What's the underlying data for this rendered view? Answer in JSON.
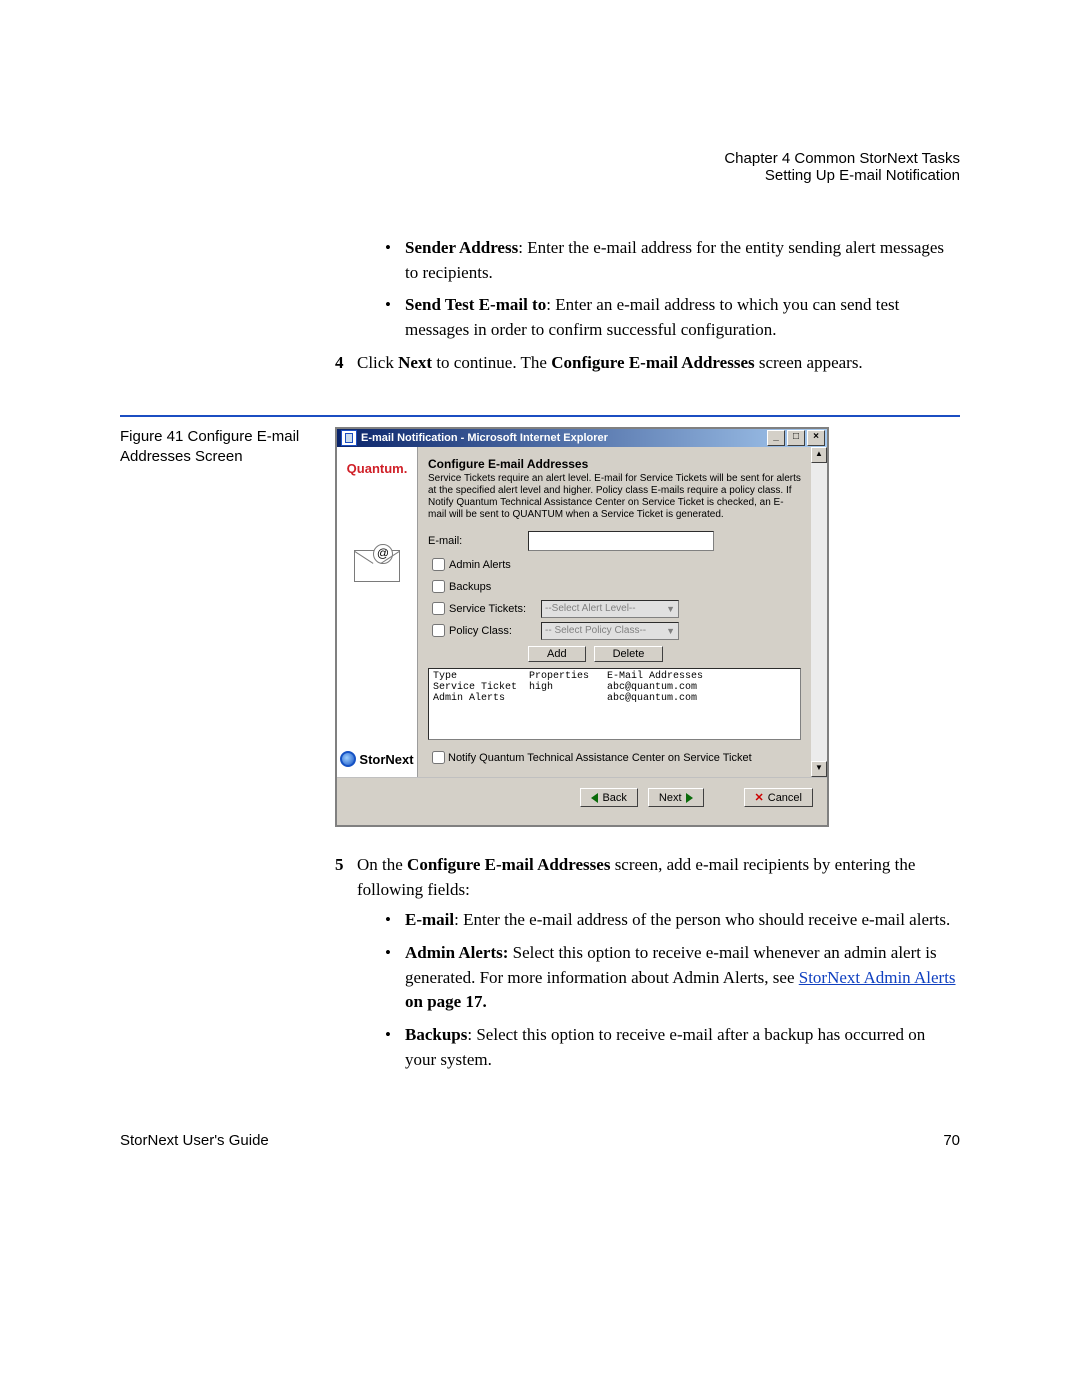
{
  "header": {
    "chapter": "Chapter 4  Common StorNext Tasks",
    "section": "Setting Up E-mail Notification"
  },
  "bullets_top": [
    {
      "bold": "Sender Address",
      "text": ": Enter the e-mail address for the entity sending alert messages to recipients."
    },
    {
      "bold": "Send Test E-mail to",
      "text": ": Enter an e-mail address to which you can send test messages in order to confirm successful configuration."
    }
  ],
  "step4": {
    "num": "4",
    "pre": "Click ",
    "b1": "Next",
    "mid": " to continue. The ",
    "b2": "Configure E-mail Addresses",
    "post": " screen appears."
  },
  "figure_label": "Figure 41  Configure E-mail Addresses Screen",
  "window": {
    "title": "E-mail Notification - Microsoft Internet Explorer",
    "brand": "Quantum.",
    "stornext": "StorNext",
    "dialog_title": "Configure E-mail Addresses",
    "dialog_desc": "Service Tickets require an alert level. E-mail for Service Tickets will be sent for alerts at the specified alert level and higher. Policy class E-mails require a policy class.\nIf Notify Quantum Technical Assistance Center on Service Ticket is checked, an E-mail will be sent to QUANTUM when a Service Ticket is generated.",
    "labels": {
      "email": "E-mail:",
      "admin": "Admin Alerts",
      "backups": "Backups",
      "service": "Service Tickets:",
      "policy": "Policy Class:",
      "alert_sel": "--Select Alert Level--",
      "policy_sel": "-- Select Policy Class--"
    },
    "buttons": {
      "add": "Add",
      "delete": "Delete",
      "back": "Back",
      "next": "Next",
      "cancel": "Cancel"
    },
    "list_header": "Type            Properties   E-Mail Addresses",
    "list_row1": "Service Ticket  high         abc@quantum.com",
    "list_row2": "Admin Alerts                 abc@quantum.com",
    "notify": "Notify Quantum Technical Assistance Center on Service Ticket"
  },
  "step5": {
    "num": "5",
    "pre": "On the ",
    "b1": "Configure E-mail Addresses",
    "post": " screen, add e-mail recipients by entering the following fields:"
  },
  "bullets_bottom": [
    {
      "bold": "E-mail",
      "text": ": Enter the e-mail address of the person who should receive e-mail alerts."
    },
    {
      "bold": "Admin Alerts:",
      "text_pre": " Select this option to receive e-mail whenever an admin alert is generated. For more information about Admin Alerts, see ",
      "link": "StorNext Admin Alerts",
      "text_post": " on page  17."
    },
    {
      "bold": "Backups",
      "text": ": Select this option to receive e-mail after a backup has occurred on your system."
    }
  ],
  "footer": {
    "left": "StorNext User's Guide",
    "right": "70"
  }
}
